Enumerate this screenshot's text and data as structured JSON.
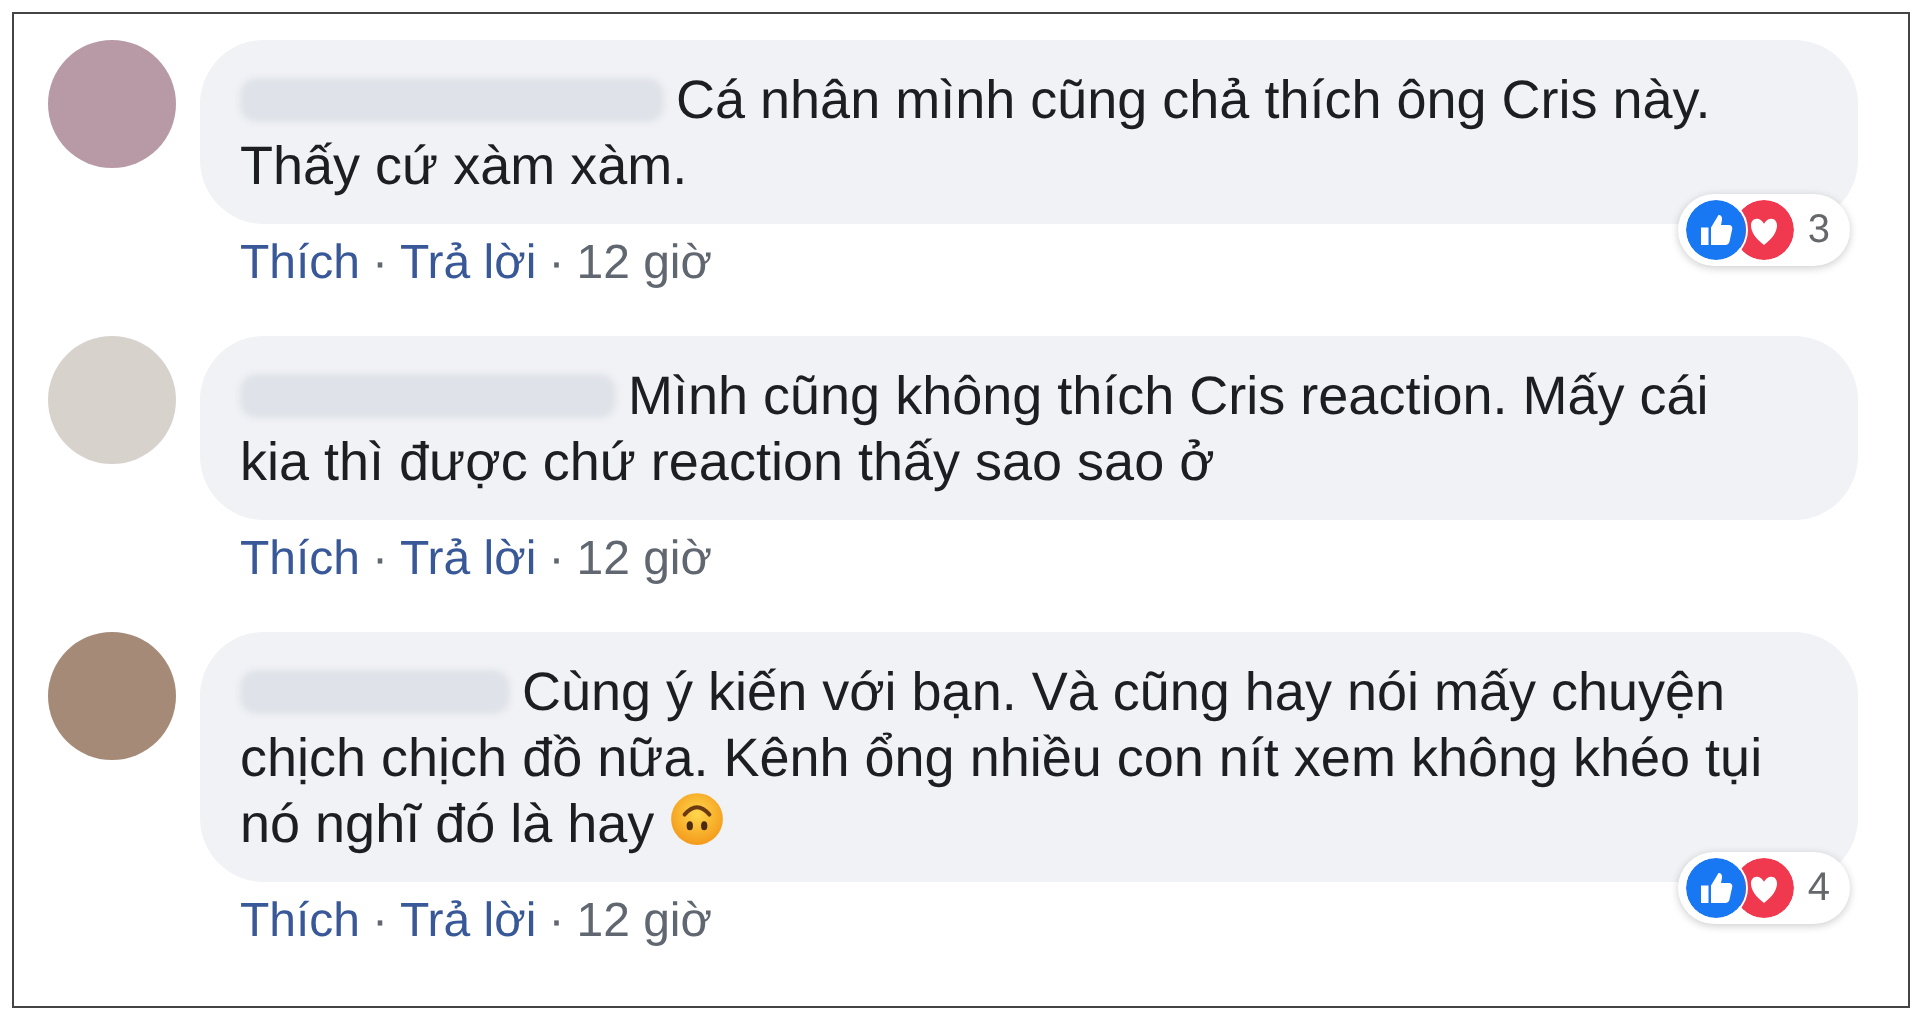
{
  "comments": [
    {
      "text": "Cá nhân mình cũng chả thích ông Cris này. Thấy cứ xàm xàm.",
      "trailing_emoji": false,
      "reactions": [
        {
          "kind": "like"
        },
        {
          "kind": "love"
        }
      ],
      "reaction_count": "3",
      "actions": [
        {
          "kind": "link",
          "text": "Thích"
        },
        {
          "kind": "dot",
          "text": "·"
        },
        {
          "kind": "link",
          "text": "Trả lời"
        },
        {
          "kind": "dot",
          "text": "·"
        },
        {
          "kind": "time",
          "text": "12 giờ"
        }
      ]
    },
    {
      "text": "Mình cũng không thích Cris reaction. Mấy cái kia thì được chứ reaction thấy sao sao ở",
      "trailing_emoji": false,
      "actions": [
        {
          "kind": "link",
          "text": "Thích"
        },
        {
          "kind": "dot",
          "text": "·"
        },
        {
          "kind": "link",
          "text": "Trả lời"
        },
        {
          "kind": "dot",
          "text": "·"
        },
        {
          "kind": "time",
          "text": "12 giờ"
        }
      ]
    },
    {
      "text": "Cùng ý kiến với bạn. Và cũng hay nói mấy chuyện chịch chịch đồ nữa. Kênh ổng nhiều con nít xem không khéo tụi nó nghĩ đó là hay",
      "trailing_emoji": true,
      "reactions": [
        {
          "kind": "like"
        },
        {
          "kind": "love"
        }
      ],
      "reaction_count": "4",
      "actions": [
        {
          "kind": "link",
          "text": "Thích"
        },
        {
          "kind": "dot",
          "text": "·"
        },
        {
          "kind": "link",
          "text": "Trả lời"
        },
        {
          "kind": "dot",
          "text": "·"
        },
        {
          "kind": "time",
          "text": "12 giờ"
        }
      ]
    }
  ]
}
